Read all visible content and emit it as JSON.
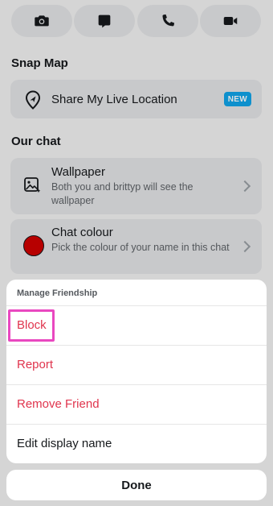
{
  "top_actions": [
    {
      "icon": "camera-icon"
    },
    {
      "icon": "chat-icon"
    },
    {
      "icon": "phone-icon"
    },
    {
      "icon": "video-icon"
    }
  ],
  "snap_map": {
    "section_title": "Snap Map",
    "share_location": {
      "label": "Share My Live Location",
      "icon": "location-pin-icon",
      "badge": "NEW",
      "badge_color": "#10a4ea"
    }
  },
  "our_chat": {
    "section_title": "Our chat",
    "wallpaper": {
      "title": "Wallpaper",
      "subtitle": "Both you and brittyp will see the wallpaper",
      "icon": "wallpaper-icon"
    },
    "chat_colour": {
      "title": "Chat colour",
      "subtitle": "Pick the colour of your name in this chat",
      "swatch_color": "#d10000"
    }
  },
  "sheet": {
    "header": "Manage Friendship",
    "items": [
      {
        "label": "Block",
        "style": "danger"
      },
      {
        "label": "Report",
        "style": "danger"
      },
      {
        "label": "Remove Friend",
        "style": "danger"
      },
      {
        "label": "Edit display name",
        "style": "normal"
      }
    ],
    "danger_color": "#e0344d",
    "highlight_color": "#e948c0"
  },
  "done_label": "Done"
}
